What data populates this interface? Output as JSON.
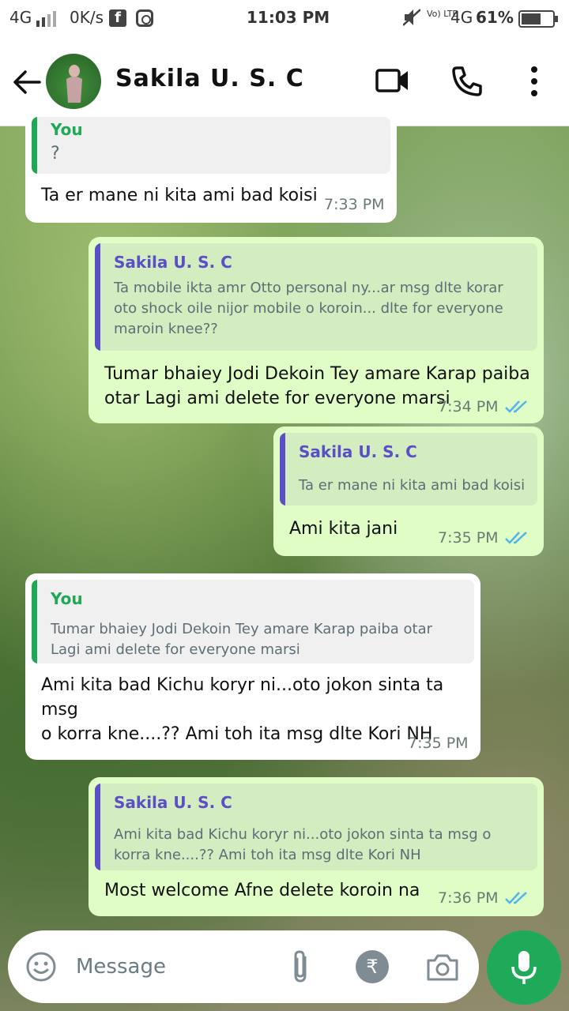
{
  "status_bar": {
    "network": "4G",
    "speed": "0K/s",
    "time": "11:03 PM",
    "volte": "Vo) LTE",
    "network2": "4G",
    "battery": "61%"
  },
  "header": {
    "contact_name": "Sakila U. S. C"
  },
  "messages": [
    {
      "direction": "incoming",
      "quote_author": "You",
      "quote_text": "?",
      "text": "Ta er mane ni kita ami bad koisi",
      "time": "7:33 PM"
    },
    {
      "direction": "outgoing",
      "quote_author": "Sakila U. S. C",
      "quote_lines": [
        "Ta mobile ikta amr Otto personal ny...ar msg dlte korar",
        "oto shock oile nijor mobile o koroin... dlte for everyone",
        "maroin knee??"
      ],
      "text_lines": [
        "Tumar bhaiey Jodi Dekoin Tey amare Karap paiba",
        "otar Lagi ami delete for everyone marsi"
      ],
      "time": "7:34 PM",
      "read": true
    },
    {
      "direction": "outgoing",
      "quote_author": "Sakila U. S. C",
      "quote_lines": [
        "Ta er mane ni kita ami bad koisi"
      ],
      "text_lines": [
        "Ami kita jani"
      ],
      "time": "7:35 PM",
      "read": true
    },
    {
      "direction": "incoming",
      "quote_author": "You",
      "quote_lines": [
        "Tumar bhaiey Jodi Dekoin Tey amare Karap paiba otar",
        "Lagi ami delete for everyone marsi"
      ],
      "text_lines": [
        "Ami kita bad Kichu koryr ni...oto jokon sinta ta msg",
        "o korra kne....?? Ami toh ita msg dlte Kori NH"
      ],
      "time": "7:35 PM"
    },
    {
      "direction": "outgoing",
      "quote_author": "Sakila U. S. C",
      "quote_lines": [
        "Ami kita bad Kichu koryr ni...oto jokon sinta ta msg o",
        "korra kne....?? Ami toh ita msg dlte Kori NH"
      ],
      "text_lines": [
        "Most welcome Afne delete koroin na"
      ],
      "time": "7:36 PM",
      "read": true
    }
  ],
  "input": {
    "placeholder": "Message",
    "rupee_symbol": "₹"
  },
  "colors": {
    "you_quote": "#1fa855",
    "contact_quote": "#5b4fc7",
    "read_ticks": "#4fb5ec",
    "mic": "#1faa59",
    "outgoing_bubble": "#e1fdc6"
  }
}
